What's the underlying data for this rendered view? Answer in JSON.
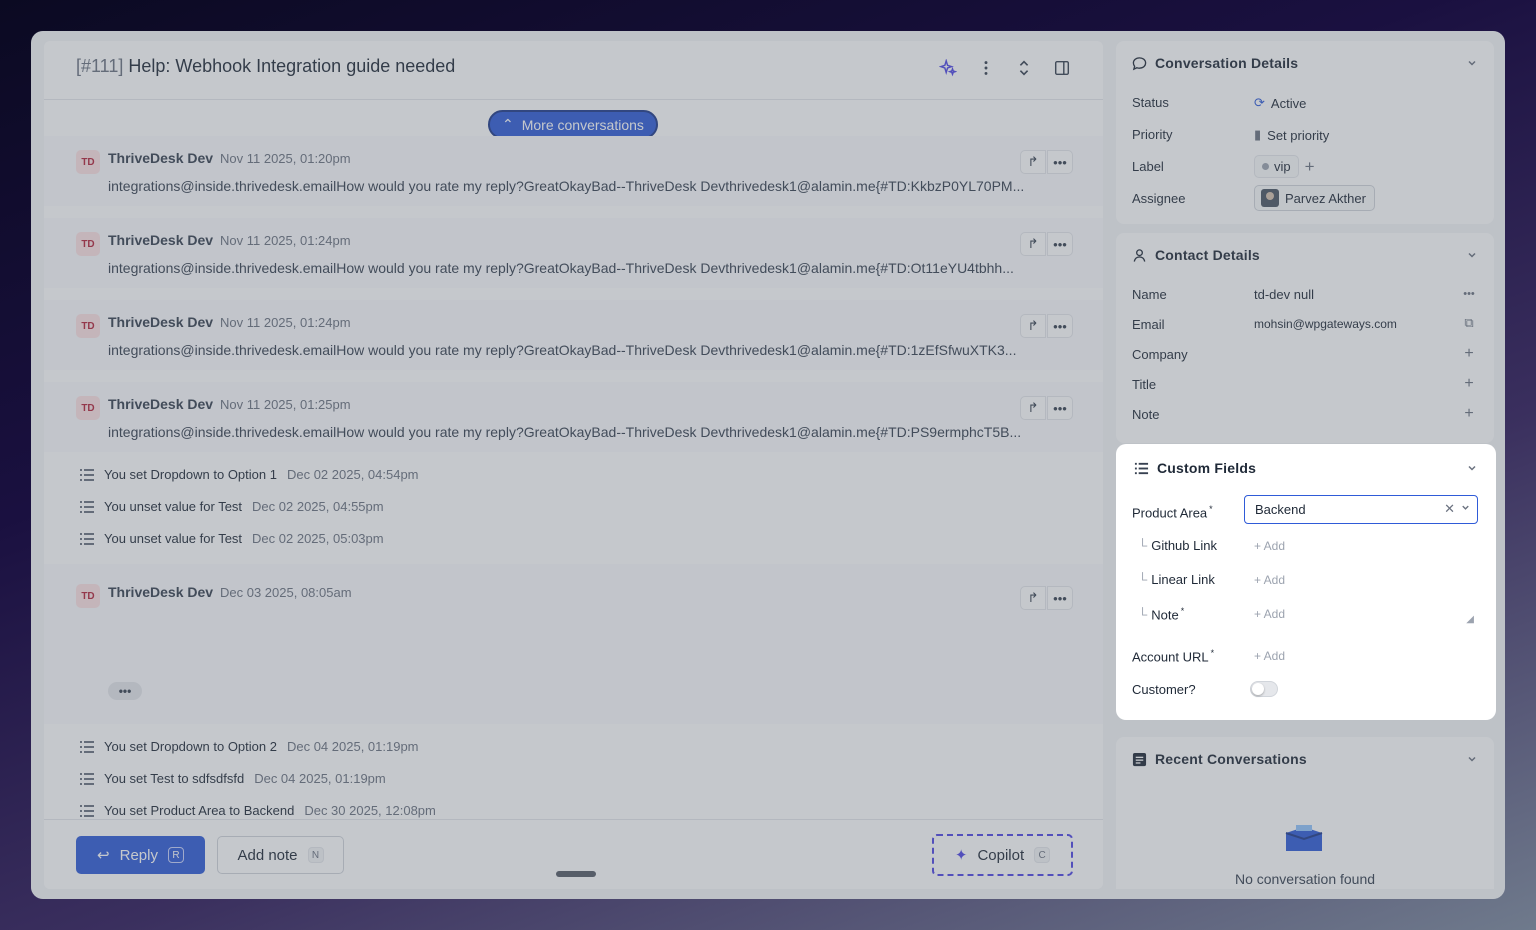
{
  "conversation": {
    "number": "[#111]",
    "title": "Help: Webhook Integration guide needed",
    "more_conversations": "More conversations",
    "messages": [
      {
        "initials": "TD",
        "author": "ThriveDesk Dev",
        "date": "Nov 11 2025, 01:20pm",
        "body": "integrations@inside.thrivedesk.emailHow would you rate my reply?GreatOkayBad--ThriveDesk Devthrivedesk1@alamin.me{#TD:KkbzP0YL70PM..."
      },
      {
        "initials": "TD",
        "author": "ThriveDesk Dev",
        "date": "Nov 11 2025, 01:24pm",
        "body": "integrations@inside.thrivedesk.emailHow would you rate my reply?GreatOkayBad--ThriveDesk Devthrivedesk1@alamin.me{#TD:Ot11eYU4tbhh..."
      },
      {
        "initials": "TD",
        "author": "ThriveDesk Dev",
        "date": "Nov 11 2025, 01:24pm",
        "body": "integrations@inside.thrivedesk.emailHow would you rate my reply?GreatOkayBad--ThriveDesk Devthrivedesk1@alamin.me{#TD:1zEfSfwuXTK3..."
      },
      {
        "initials": "TD",
        "author": "ThriveDesk Dev",
        "date": "Nov 11 2025, 01:25pm",
        "body": "integrations@inside.thrivedesk.emailHow would you rate my reply?GreatOkayBad--ThriveDesk Devthrivedesk1@alamin.me{#TD:PS9ermphcT5B..."
      }
    ],
    "activities_1": [
      {
        "text": "You set Dropdown to Option 1",
        "date": "Dec 02 2025, 04:54pm"
      },
      {
        "text": "You unset value for Test",
        "date": "Dec 02 2025, 04:55pm"
      },
      {
        "text": "You unset value for Test",
        "date": "Dec 02 2025, 05:03pm"
      }
    ],
    "message_5": {
      "initials": "TD",
      "author": "ThriveDesk Dev",
      "date": "Dec 03 2025, 08:05am"
    },
    "ellipsis": "•••",
    "activities_2": [
      {
        "text": "You set Dropdown to Option 2",
        "date": "Dec 04 2025, 01:19pm"
      },
      {
        "text": "You set Test to sdfsdfsfd",
        "date": "Dec 04 2025, 01:19pm"
      },
      {
        "text": "You set Product Area to Backend",
        "date": "Dec 30 2025, 12:08pm"
      }
    ]
  },
  "composer": {
    "reply": "Reply",
    "reply_key": "R",
    "add_note": "Add note",
    "note_key": "N",
    "copilot": "Copilot",
    "copilot_key": "C"
  },
  "conversation_details": {
    "title": "Conversation Details",
    "status_label": "Status",
    "status_value": "Active",
    "priority_label": "Priority",
    "priority_value": "Set priority",
    "label_label": "Label",
    "label_value": "vip",
    "assignee_label": "Assignee",
    "assignee_value": "Parvez Akther"
  },
  "contact_details": {
    "title": "Contact Details",
    "name_label": "Name",
    "name_value": "td-dev null",
    "email_label": "Email",
    "email_value": "mohsin@wpgateways.com",
    "company_label": "Company",
    "title_label": "Title",
    "note_label": "Note"
  },
  "custom_fields": {
    "title": "Custom Fields",
    "product_area_label": "Product Area",
    "product_area_value": "Backend",
    "github_label": "Github Link",
    "linear_label": "Linear Link",
    "note_label": "Note",
    "account_url_label": "Account URL",
    "customer_label": "Customer?",
    "add_text": "+ Add",
    "customer_enabled": false
  },
  "recent_conversations": {
    "title": "Recent Conversations",
    "empty": "No conversation found"
  },
  "colors": {
    "primary": "#2f5bd8",
    "copilot_border": "#4f46e5"
  }
}
